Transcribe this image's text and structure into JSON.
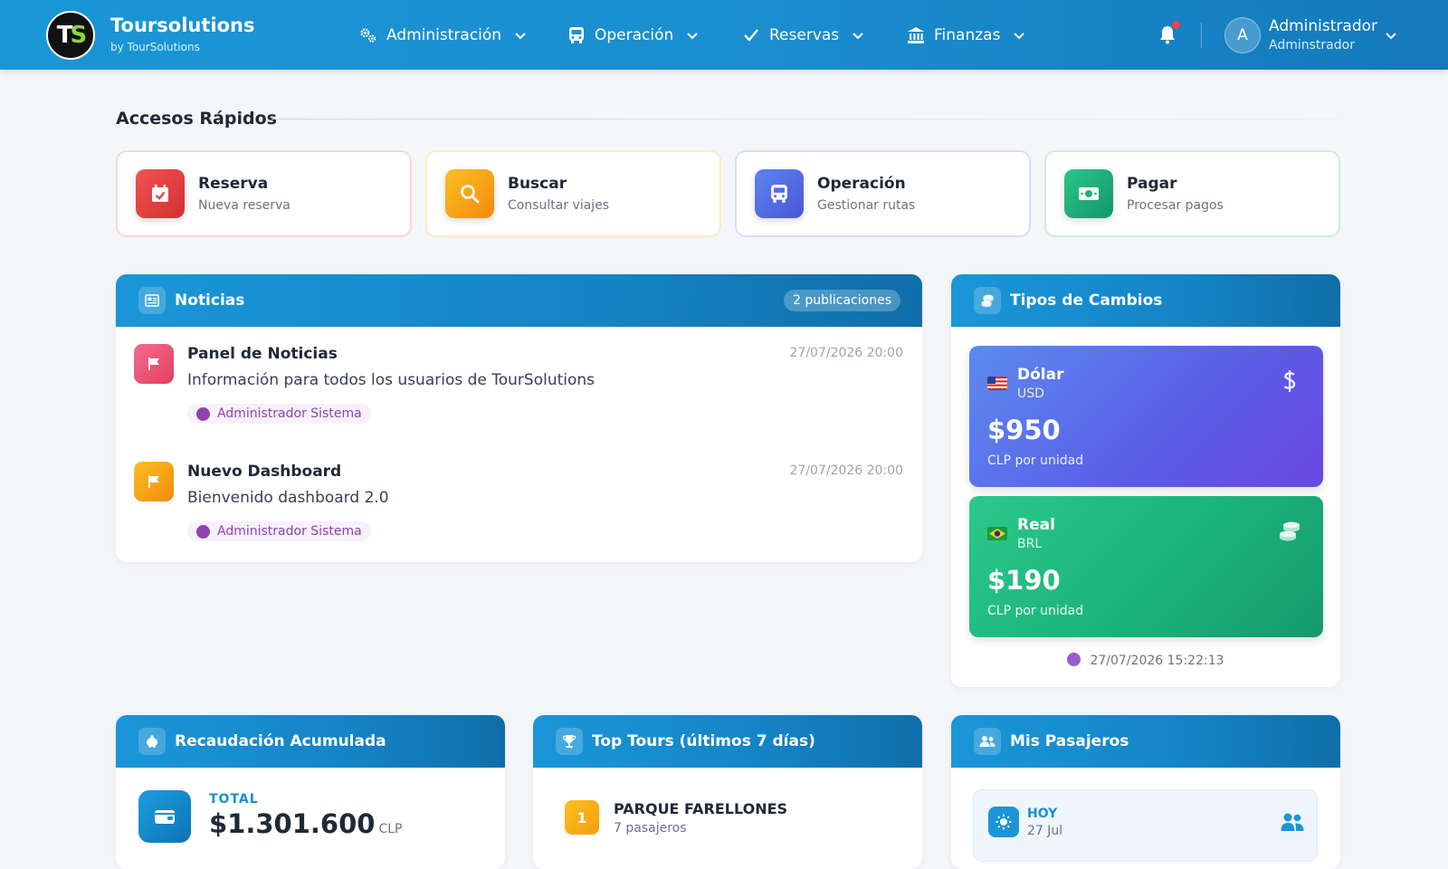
{
  "brand": {
    "title": "Toursolutions",
    "subtitle": "by TourSolutions",
    "logo_text_t": "T",
    "logo_text_s": "S"
  },
  "nav": [
    {
      "label": "Administración",
      "icon": "cogs-icon"
    },
    {
      "label": "Operación",
      "icon": "bus-icon"
    },
    {
      "label": "Reservas",
      "icon": "check-icon"
    },
    {
      "label": "Finanzas",
      "icon": "bank-icon"
    }
  ],
  "user": {
    "avatar": "A",
    "name": "Administrador",
    "role": "Adminstrador",
    "has_notification": true
  },
  "quick_access": {
    "title": "Accesos Rápidos",
    "items": [
      {
        "title": "Reserva",
        "subtitle": "Nueva reserva",
        "icon": "calendar-check-icon",
        "color": "#e53e3e"
      },
      {
        "title": "Buscar",
        "subtitle": "Consultar viajes",
        "icon": "search-icon",
        "color": "#f59e0b"
      },
      {
        "title": "Operación",
        "subtitle": "Gestionar rutas",
        "icon": "bus-icon",
        "color": "#4f6fe6"
      },
      {
        "title": "Pagar",
        "subtitle": "Procesar pagos",
        "icon": "money-icon",
        "color": "#1fae7a"
      }
    ]
  },
  "news": {
    "title": "Noticias",
    "count_label": "2 publicaciones",
    "items": [
      {
        "title": "Panel de Noticias",
        "date": "27/07/2026 20:00",
        "body": "Información para todos los usuarios de TourSolutions",
        "author": "Administrador Sistema",
        "color": "#ec4d7a"
      },
      {
        "title": "Nuevo Dashboard",
        "date": "27/07/2026 20:00",
        "body": "Bienvenido dashboard 2.0",
        "author": "Administrador Sistema",
        "color": "#f59e0b"
      }
    ]
  },
  "exchange": {
    "title": "Tipos de Cambios",
    "rates": [
      {
        "name": "Dólar",
        "code": "USD",
        "value": "$950",
        "unit": "CLP por unidad",
        "icon": "dollar-icon"
      },
      {
        "name": "Real",
        "code": "BRL",
        "value": "$190",
        "unit": "CLP por unidad",
        "icon": "coins-icon"
      }
    ],
    "updated": "27/07/2026 15:22:13"
  },
  "revenue": {
    "title": "Recaudación Acumulada",
    "label": "TOTAL",
    "value": "$1.301.600",
    "currency": "CLP"
  },
  "top_tours": {
    "title": "Top Tours (últimos 7 días)",
    "items": [
      {
        "rank": "1",
        "name": "PARQUE FARELLONES",
        "passengers": "7 pasajeros"
      }
    ]
  },
  "passengers": {
    "title": "Mis Pasajeros",
    "today_label": "HOY",
    "today_date": "27 Jul"
  }
}
